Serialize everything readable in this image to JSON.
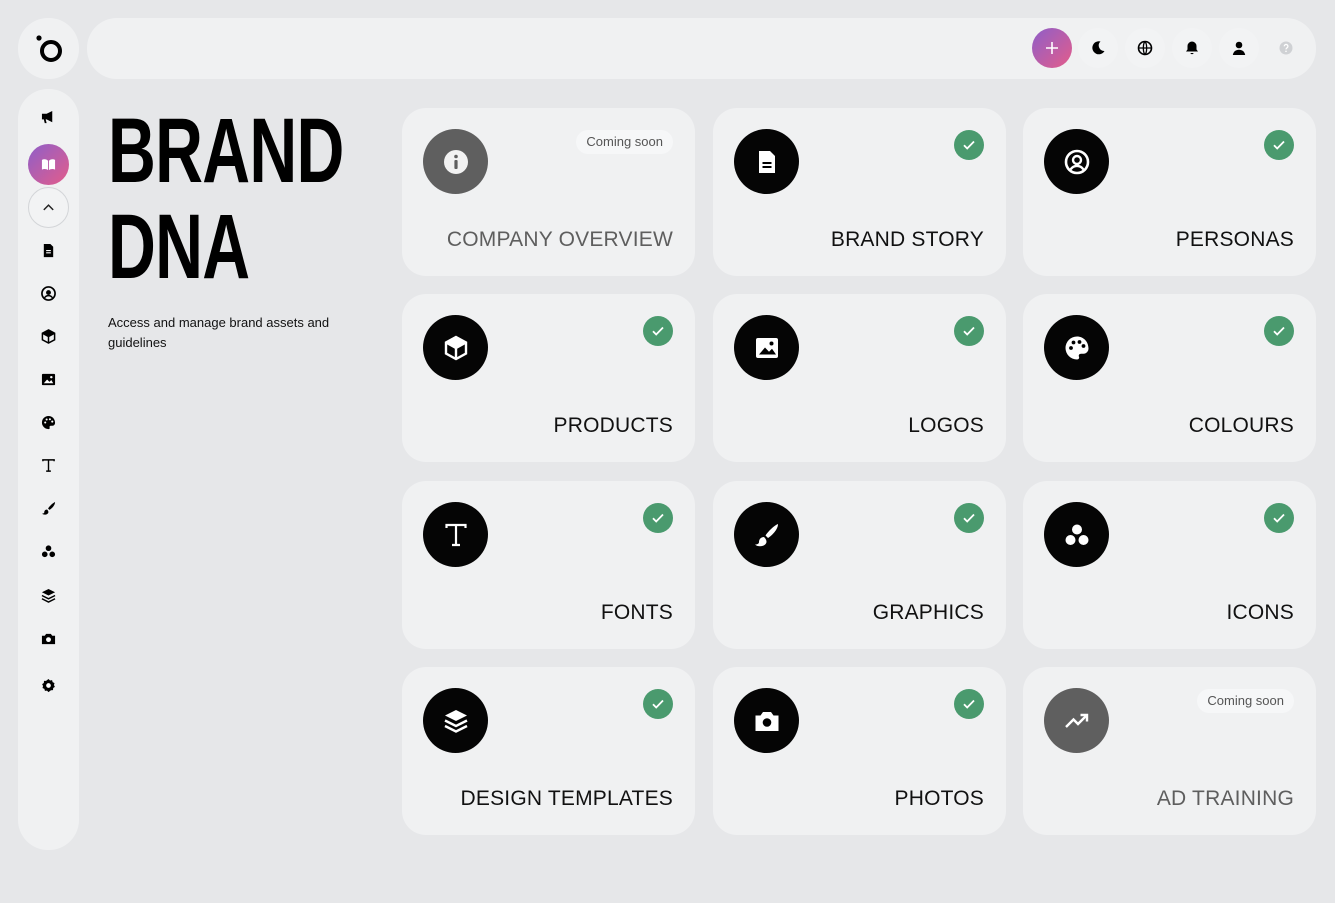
{
  "app": {
    "brand_logo_icon": "brand-logo-icon"
  },
  "sidebar": {
    "items": [
      {
        "name": "campaign",
        "icon": "megaphone-icon"
      },
      {
        "name": "brand-dna",
        "icon": "book-icon",
        "active": true
      },
      {
        "name": "collapse",
        "icon": "chevron-up-icon"
      },
      {
        "name": "brand-story",
        "icon": "document-icon"
      },
      {
        "name": "personas",
        "icon": "user-circle-icon"
      },
      {
        "name": "products",
        "icon": "cube-icon"
      },
      {
        "name": "logos",
        "icon": "image-icon"
      },
      {
        "name": "colours",
        "icon": "palette-icon"
      },
      {
        "name": "fonts",
        "icon": "type-icon"
      },
      {
        "name": "graphics",
        "icon": "brush-icon"
      },
      {
        "name": "icons",
        "icon": "shapes-icon"
      },
      {
        "name": "design-templates",
        "icon": "layers-icon"
      },
      {
        "name": "photos",
        "icon": "camera-icon"
      },
      {
        "name": "settings",
        "icon": "gear-icon"
      }
    ]
  },
  "topbar": {
    "buttons": [
      {
        "name": "create",
        "icon": "plus-icon"
      },
      {
        "name": "theme",
        "icon": "moon-icon"
      },
      {
        "name": "language",
        "icon": "globe-icon"
      },
      {
        "name": "notifications",
        "icon": "bell-icon"
      },
      {
        "name": "profile",
        "icon": "user-icon"
      },
      {
        "name": "help",
        "icon": "help-icon"
      }
    ]
  },
  "hero": {
    "title_line1": "BRAND",
    "title_line2": "DNA",
    "subtitle": "Access and manage brand assets and guidelines"
  },
  "cards": [
    {
      "label": "COMPANY OVERVIEW",
      "icon": "info-icon",
      "status": "soon",
      "badge": "Coming soon"
    },
    {
      "label": "BRAND STORY",
      "icon": "document-icon",
      "status": "done"
    },
    {
      "label": "PERSONAS",
      "icon": "user-circle-icon",
      "status": "done"
    },
    {
      "label": "PRODUCTS",
      "icon": "cube-icon",
      "status": "done"
    },
    {
      "label": "LOGOS",
      "icon": "image-icon",
      "status": "done"
    },
    {
      "label": "COLOURS",
      "icon": "palette-icon",
      "status": "done"
    },
    {
      "label": "FONTS",
      "icon": "type-icon",
      "status": "done"
    },
    {
      "label": "GRAPHICS",
      "icon": "brush-icon",
      "status": "done"
    },
    {
      "label": "ICONS",
      "icon": "shapes-icon",
      "status": "done"
    },
    {
      "label": "DESIGN TEMPLATES",
      "icon": "layers-icon",
      "status": "done"
    },
    {
      "label": "PHOTOS",
      "icon": "camera-icon",
      "status": "done"
    },
    {
      "label": "AD TRAINING",
      "icon": "trend-up-icon",
      "status": "soon",
      "badge": "Coming soon"
    }
  ],
  "colors": {
    "background": "#e6e7e9",
    "panel": "#f0f1f2",
    "check_green": "#4a9a6e",
    "accent_gradient_start": "#8e5fc9",
    "accent_gradient_end": "#e45c8a"
  }
}
